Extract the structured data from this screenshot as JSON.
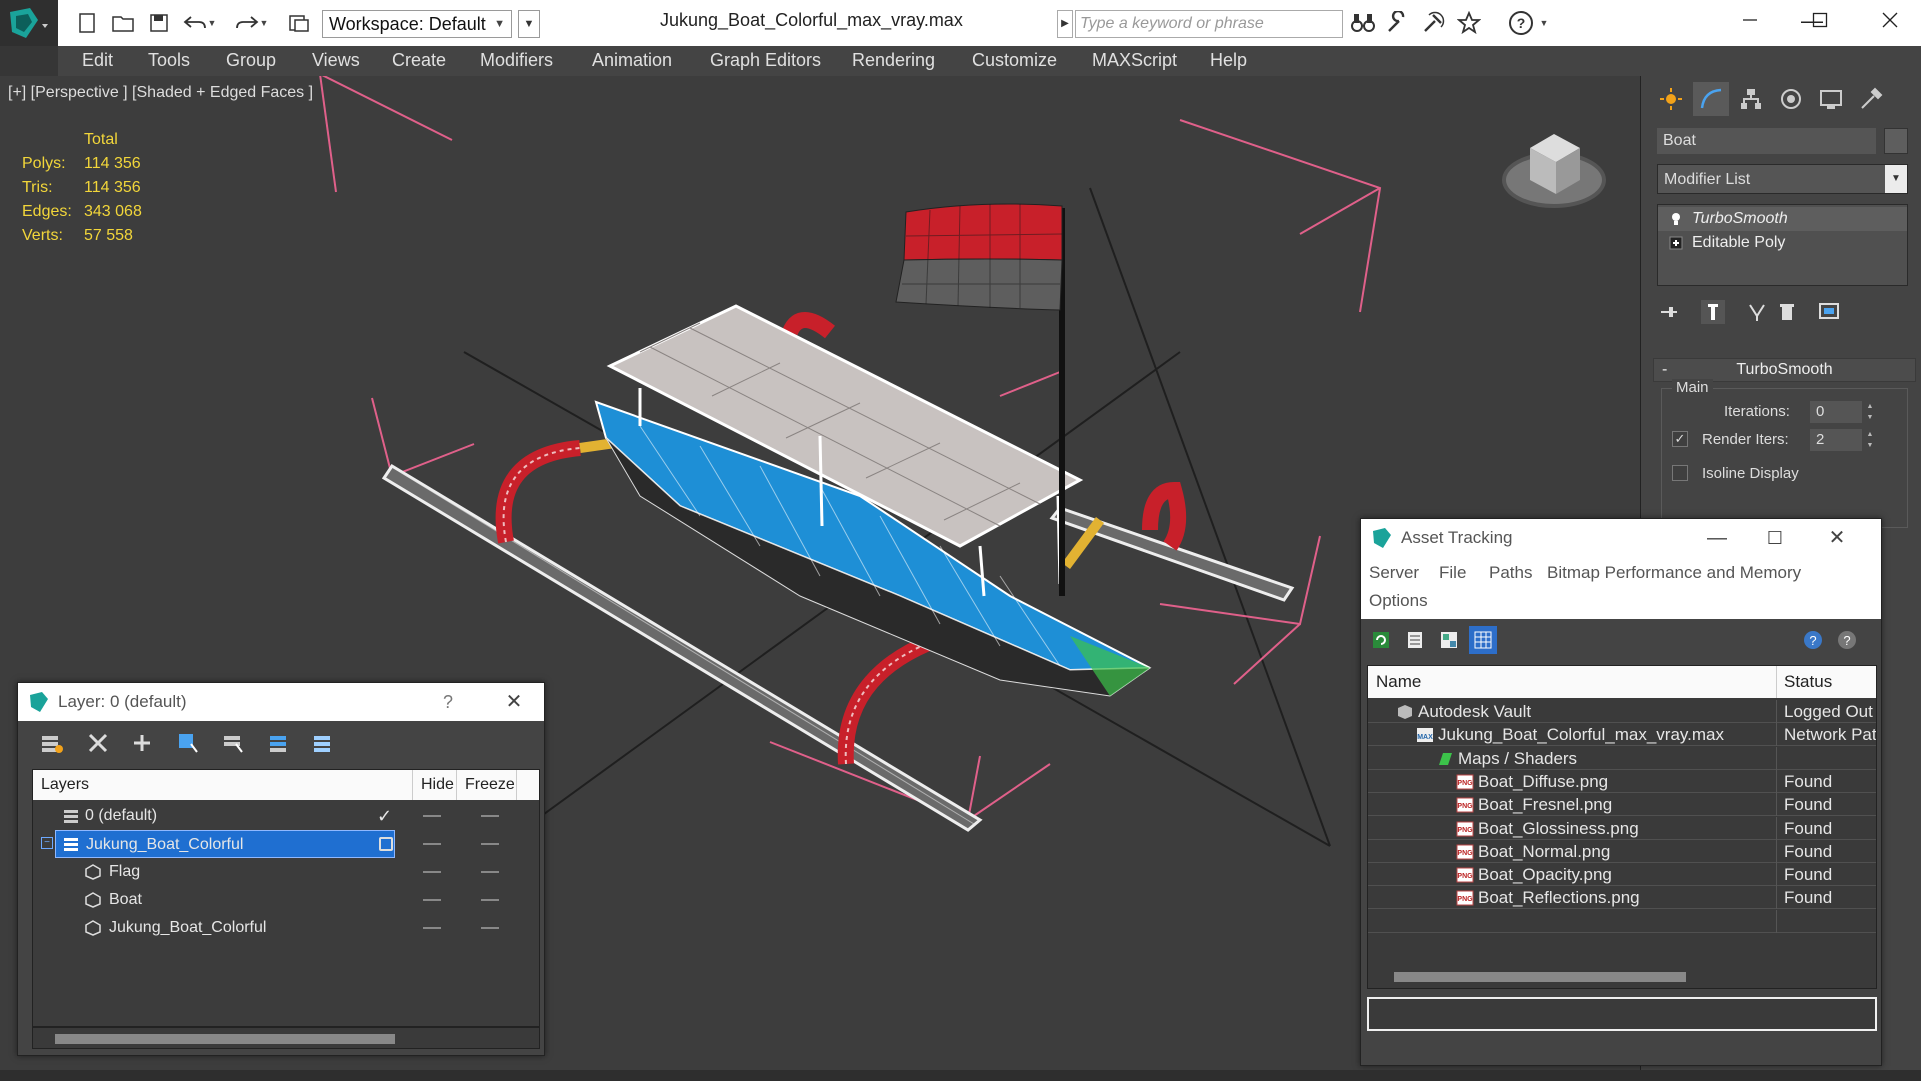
{
  "titlebar": {
    "workspace": "Workspace: Default",
    "document_title": "Jukung_Boat_Colorful_max_vray.max",
    "search_placeholder": "Type a keyword or phrase"
  },
  "menubar": [
    "Edit",
    "Tools",
    "Group",
    "Views",
    "Create",
    "Modifiers",
    "Animation",
    "Graph Editors",
    "Rendering",
    "Customize",
    "MAXScript",
    "Help"
  ],
  "viewport": {
    "label": "[+] [Perspective ] [Shaded + Edged Faces ]",
    "stats": {
      "header": "Total",
      "rows": [
        {
          "k": "Polys:",
          "v": "114 356"
        },
        {
          "k": "Tris:",
          "v": "114 356"
        },
        {
          "k": "Edges:",
          "v": "343 068"
        },
        {
          "k": "Verts:",
          "v": "57 558"
        }
      ]
    }
  },
  "command_panel": {
    "object_name": "Boat",
    "modifier_list": "Modifier List",
    "stack": [
      "TurboSmooth",
      "Editable Poly"
    ],
    "rollout_title": "TurboSmooth",
    "group_main": "Main",
    "iterations_label": "Iterations:",
    "iterations_value": "0",
    "render_iters_label": "Render Iters:",
    "render_iters_value": "2",
    "isoline_label": "Isoline Display"
  },
  "layer_window": {
    "title": "Layer: 0 (default)",
    "help": "?",
    "columns": [
      "Layers",
      "Hide",
      "Freeze"
    ],
    "rows": [
      {
        "name": "0 (default)",
        "checked": true
      },
      {
        "name": "Jukung_Boat_Colorful",
        "selected": true
      },
      {
        "name": "Flag"
      },
      {
        "name": "Boat"
      },
      {
        "name": "Jukung_Boat_Colorful"
      }
    ]
  },
  "asset_window": {
    "title": "Asset Tracking",
    "menu": [
      "Server",
      "File",
      "Paths",
      "Bitmap Performance and Memory",
      "Options"
    ],
    "columns": [
      "Name",
      "Status"
    ],
    "rows": [
      {
        "name": "Autodesk Vault",
        "status": "Logged Out",
        "indent": 0,
        "icon": "vault-icon"
      },
      {
        "name": "Jukung_Boat_Colorful_max_vray.max",
        "status": "Network Pat",
        "indent": 1,
        "icon": "max-file-icon"
      },
      {
        "name": "Maps / Shaders",
        "status": "",
        "indent": 2,
        "icon": "maps-icon"
      },
      {
        "name": "Boat_Diffuse.png",
        "status": "Found",
        "indent": 3,
        "icon": "png-icon"
      },
      {
        "name": "Boat_Fresnel.png",
        "status": "Found",
        "indent": 3,
        "icon": "png-icon"
      },
      {
        "name": "Boat_Glossiness.png",
        "status": "Found",
        "indent": 3,
        "icon": "png-icon"
      },
      {
        "name": "Boat_Normal.png",
        "status": "Found",
        "indent": 3,
        "icon": "png-icon"
      },
      {
        "name": "Boat_Opacity.png",
        "status": "Found",
        "indent": 3,
        "icon": "png-icon"
      },
      {
        "name": "Boat_Reflections.png",
        "status": "Found",
        "indent": 3,
        "icon": "png-icon"
      }
    ]
  },
  "colors": {
    "stats_text": "#f2d63a",
    "selection": "#1f6fd1",
    "bbox_pink": "#e0608a",
    "hull_blue": "#1e8fd6",
    "float_red": "#c8202a"
  }
}
